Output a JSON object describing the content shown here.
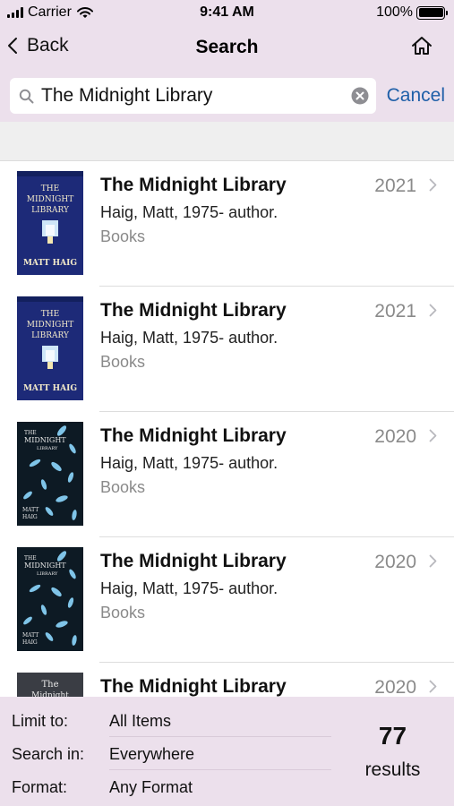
{
  "status_bar": {
    "carrier": "Carrier",
    "time": "9:41 AM",
    "battery": "100%",
    "battery_level": 1.0
  },
  "nav": {
    "back_label": "Back",
    "title": "Search",
    "home_icon": "home-icon"
  },
  "search": {
    "query": "The Midnight Library",
    "placeholder": "",
    "cancel_label": "Cancel"
  },
  "results": [
    {
      "title": "The Midnight Library",
      "author": "Haig, Matt, 1975- author.",
      "format": "Books",
      "year": "2021",
      "cover": "cover-blue"
    },
    {
      "title": "The Midnight Library",
      "author": "Haig, Matt, 1975- author.",
      "format": "Books",
      "year": "2021",
      "cover": "cover-blue"
    },
    {
      "title": "The Midnight Library",
      "author": "Haig, Matt, 1975- author.",
      "format": "Books",
      "year": "2020",
      "cover": "cover-dark"
    },
    {
      "title": "The Midnight Library",
      "author": "Haig, Matt, 1975- author.",
      "format": "Books",
      "year": "2020",
      "cover": "cover-dark"
    },
    {
      "title": "The Midnight Library",
      "author": "",
      "format": "",
      "year": "2020",
      "cover": "cover-grey"
    }
  ],
  "footer": {
    "filters": [
      {
        "label": "Limit to:",
        "value": "All Items"
      },
      {
        "label": "Search in:",
        "value": "Everywhere"
      },
      {
        "label": "Format:",
        "value": "Any Format"
      }
    ],
    "count": "77",
    "count_label": "results"
  },
  "colors": {
    "bar_bg": "#ece0ec",
    "link": "#1f5fa8",
    "muted": "#8a8a8a"
  }
}
